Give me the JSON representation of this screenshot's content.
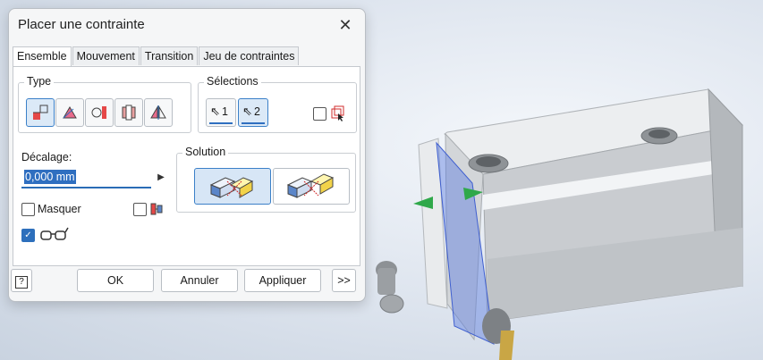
{
  "dialog": {
    "title": "Placer une contrainte",
    "close_symbol": "✕",
    "tabs": [
      "Ensemble",
      "Mouvement",
      "Transition",
      "Jeu de contraintes"
    ],
    "active_tab": "Ensemble",
    "type": {
      "legend": "Type",
      "icons": [
        "mate-constraint-icon",
        "angle-constraint-icon",
        "tangent-constraint-icon",
        "insert-constraint-icon",
        "symmetry-constraint-icon"
      ]
    },
    "selections": {
      "legend": "Sélections",
      "first": "1",
      "second": "2",
      "first_color": "#2f6fc0",
      "second_color": "#2f6fc0"
    },
    "offset": {
      "label": "Décalage:",
      "value": "0,000 mm",
      "arrow": "▶"
    },
    "solution": {
      "legend": "Solution"
    },
    "hide_label": "Masquer",
    "preview_checked": true,
    "buttons": {
      "help": "?",
      "ok": "OK",
      "cancel": "Annuler",
      "apply": "Appliquer",
      "more": ">>"
    },
    "accent_color": "#2f6fc0"
  }
}
